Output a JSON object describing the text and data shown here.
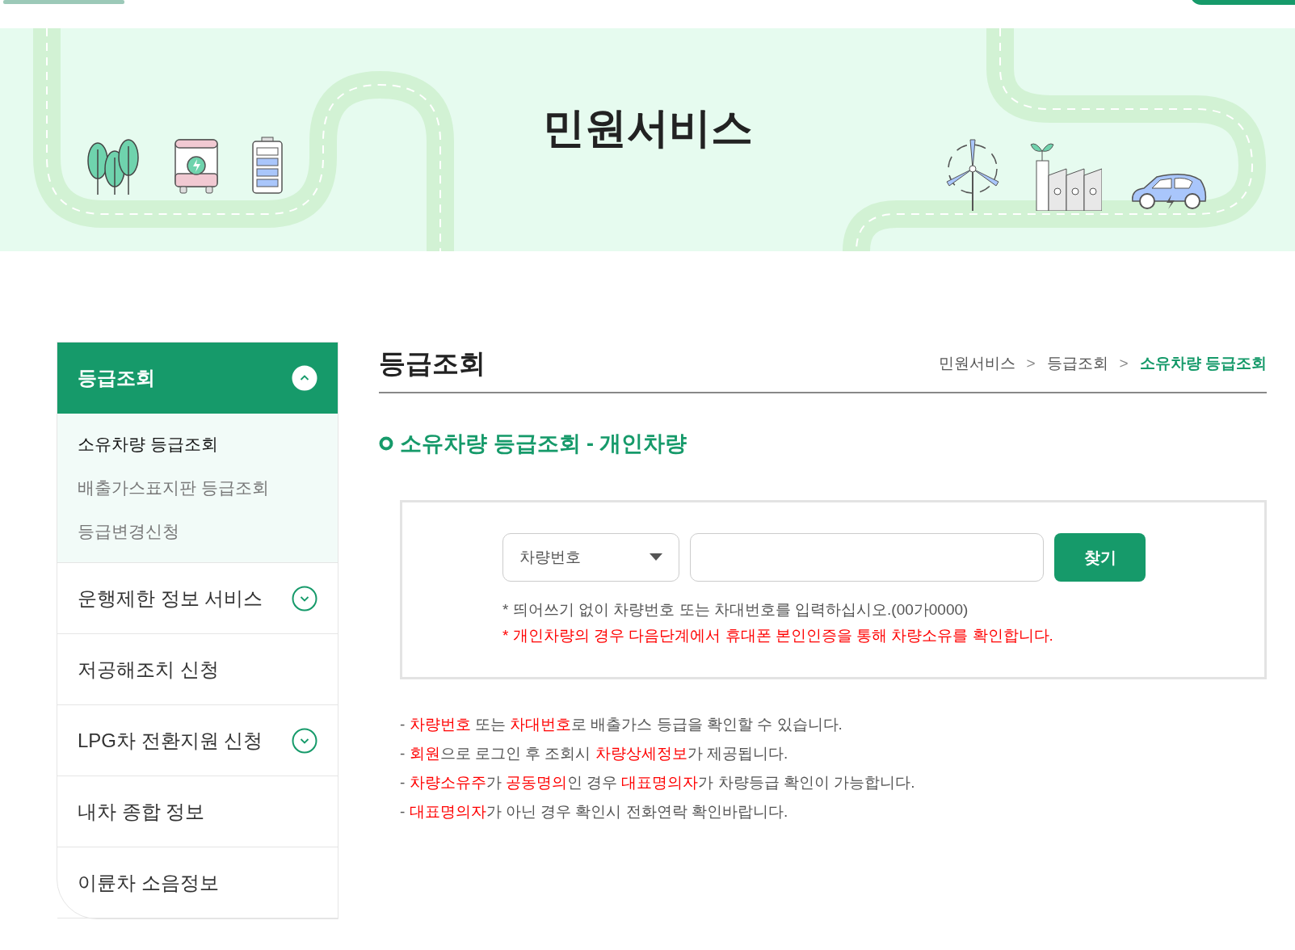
{
  "banner": {
    "title": "민원서비스"
  },
  "sidebar": {
    "items": [
      {
        "label": "등급조회",
        "expanded": true,
        "selected": true,
        "children": [
          {
            "label": "소유차량 등급조회",
            "selected": true
          },
          {
            "label": "배출가스표지판 등급조회",
            "selected": false
          },
          {
            "label": "등급변경신청",
            "selected": false
          }
        ]
      },
      {
        "label": "운행제한 정보 서비스",
        "expanded": false,
        "selected": false
      },
      {
        "label": "저공해조치 신청",
        "selected": false
      },
      {
        "label": "LPG차 전환지원 신청",
        "expanded": false,
        "selected": false
      },
      {
        "label": "내차 종합 정보",
        "selected": false
      },
      {
        "label": "이륜차 소음정보",
        "selected": false
      }
    ]
  },
  "page": {
    "title": "등급조회",
    "breadcrumb": [
      {
        "label": "민원서비스",
        "selected": false
      },
      {
        "label": ">",
        "kind": "separator"
      },
      {
        "label": "등급조회",
        "selected": false
      },
      {
        "label": ">",
        "kind": "separator"
      },
      {
        "label": "소유차량 등급조회",
        "selected": true
      }
    ],
    "section_title": "소유차량 등급조회 - 개인차량"
  },
  "search": {
    "select": "차량번호",
    "button": "찾기",
    "hints": [
      {
        "text": "* 띄어쓰기 없이 차량번호 또는 차대번호를 입력하십시오.(00가0000)",
        "warning": false
      },
      {
        "text": "* 개인차량의 경우 다음단계에서 휴대폰 본인인증을 통해 차량소유를 확인합니다.",
        "warning": true
      }
    ]
  },
  "notes": [
    [
      {
        "text": "- ",
        "highlight": false
      },
      {
        "text": "차량번호",
        "highlight": true
      },
      {
        "text": " 또는 ",
        "highlight": false
      },
      {
        "text": "차대번호",
        "highlight": true
      },
      {
        "text": "로 배출가스 등급을 확인할 수 있습니다.",
        "highlight": false
      }
    ],
    [
      {
        "text": "- ",
        "highlight": false
      },
      {
        "text": "회원",
        "highlight": true
      },
      {
        "text": "으로 로그인 후 조회시 ",
        "highlight": false
      },
      {
        "text": "차량상세정보",
        "highlight": true
      },
      {
        "text": "가 제공됩니다.",
        "highlight": false
      }
    ],
    [
      {
        "text": "- ",
        "highlight": false
      },
      {
        "text": "차량소유주",
        "highlight": true
      },
      {
        "text": "가 ",
        "highlight": false
      },
      {
        "text": "공동명의",
        "highlight": true
      },
      {
        "text": "인 경우 ",
        "highlight": false
      },
      {
        "text": "대표명의자",
        "highlight": true
      },
      {
        "text": "가 차량등급 확인이 가능합니다.",
        "highlight": false
      }
    ],
    [
      {
        "text": "- ",
        "highlight": false
      },
      {
        "text": "대표명의자",
        "highlight": true
      },
      {
        "text": "가 아닌 경우 확인시 전화연락 확인바랍니다.",
        "highlight": false
      }
    ]
  ]
}
